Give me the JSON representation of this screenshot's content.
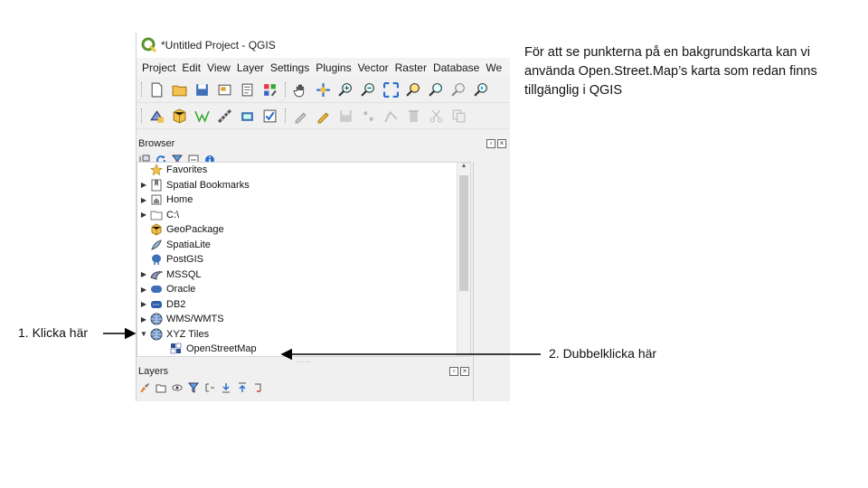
{
  "window": {
    "title": "*Untitled Project - QGIS"
  },
  "menu": [
    "Project",
    "Edit",
    "View",
    "Layer",
    "Settings",
    "Plugins",
    "Vector",
    "Raster",
    "Database",
    "We"
  ],
  "browser": {
    "title": "Browser",
    "items": [
      {
        "label": "Favorites",
        "icon": "star-icon",
        "expander": false
      },
      {
        "label": "Spatial Bookmarks",
        "icon": "bookmark-icon",
        "expander": true
      },
      {
        "label": "Home",
        "icon": "home-icon",
        "expander": true
      },
      {
        "label": "C:\\",
        "icon": "drive-icon",
        "expander": true
      },
      {
        "label": "GeoPackage",
        "icon": "geopackage-icon",
        "expander": false
      },
      {
        "label": "SpatiaLite",
        "icon": "spatialite-icon",
        "expander": false
      },
      {
        "label": "PostGIS",
        "icon": "postgis-icon",
        "expander": false
      },
      {
        "label": "MSSQL",
        "icon": "mssql-icon",
        "expander": true
      },
      {
        "label": "Oracle",
        "icon": "oracle-icon",
        "expander": true
      },
      {
        "label": "DB2",
        "icon": "db2-icon",
        "expander": true
      },
      {
        "label": "WMS/WMTS",
        "icon": "globe-icon",
        "expander": true
      },
      {
        "label": "XYZ Tiles",
        "icon": "globe-icon",
        "expander": true,
        "expanded": true
      },
      {
        "label": "OpenStreetMap",
        "icon": "xyz-tile-icon",
        "child": true
      }
    ]
  },
  "layers": {
    "title": "Layers"
  },
  "annotation": {
    "note": "För att se punkterna på en bakgrundskarta kan vi använda Open.Street.Map’s karta som redan finns tillgänglig i QGIS",
    "step1": "1. Klicka här",
    "step2": "2. Dubbelklicka här"
  },
  "colors": {
    "arrow": "#000000",
    "qgis_green": "#589632",
    "qgis_yellow": "#f0c73c"
  }
}
